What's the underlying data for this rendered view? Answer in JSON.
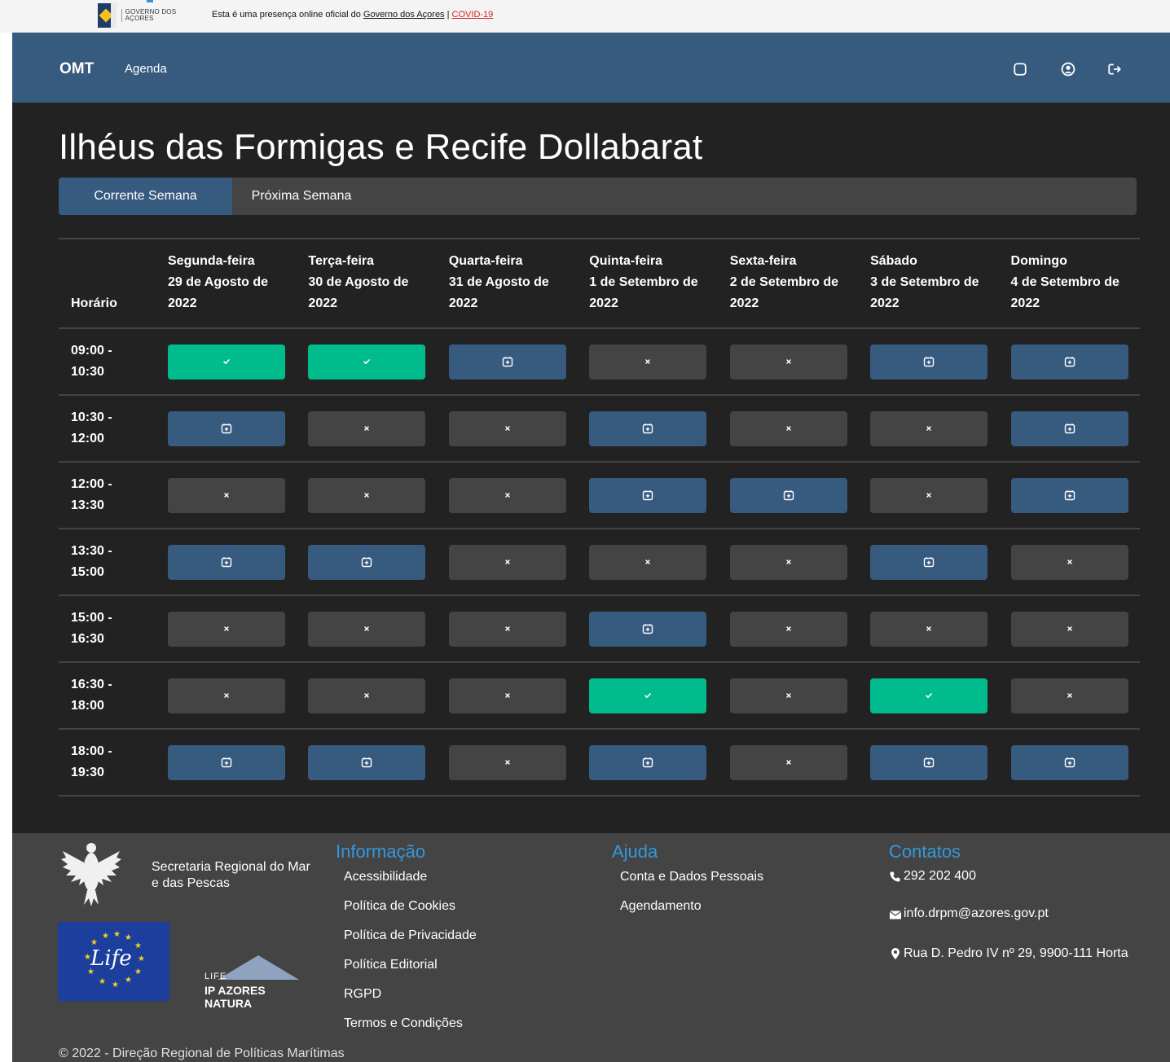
{
  "gov_bar": {
    "logo_text": "GOVERNO DOS AÇORES",
    "intro": "Esta é uma presença online oficial do ",
    "gov_link": "Governo dos Açores",
    "separator": " | ",
    "covid_link": "COVID-19"
  },
  "navbar": {
    "brand": "OMT",
    "agenda": "Agenda",
    "icons": [
      "theme-toggle-icon",
      "user-circle-icon",
      "logout-icon"
    ]
  },
  "page": {
    "title": "Ilhéus das Formigas e Recife Dollabarat",
    "tabs": [
      {
        "label": "Corrente Semana",
        "active": true
      },
      {
        "label": "Próxima Semana",
        "active": false
      }
    ]
  },
  "schedule": {
    "time_header": "Horário",
    "days": [
      {
        "name": "Segunda-feira",
        "date": "29 de Agosto de",
        "year": "2022"
      },
      {
        "name": "Terça-feira",
        "date": "30 de Agosto de",
        "year": "2022"
      },
      {
        "name": "Quarta-feira",
        "date": "31 de Agosto de",
        "year": "2022"
      },
      {
        "name": "Quinta-feira",
        "date": "1 de Setembro de",
        "year": "2022"
      },
      {
        "name": "Sexta-feira",
        "date": "2 de Setembro de",
        "year": "2022"
      },
      {
        "name": "Sábado",
        "date": "3 de Setembro de",
        "year": "2022"
      },
      {
        "name": "Domingo",
        "date": "4 de Setembro de",
        "year": "2022"
      }
    ],
    "rows": [
      {
        "start": "09:00 -",
        "end": "10:30",
        "slots": [
          "booked",
          "booked",
          "available",
          "unavailable",
          "unavailable",
          "available",
          "available"
        ]
      },
      {
        "start": "10:30 -",
        "end": "12:00",
        "slots": [
          "available",
          "unavailable",
          "unavailable",
          "available",
          "unavailable",
          "unavailable",
          "available"
        ]
      },
      {
        "start": "12:00 -",
        "end": "13:30",
        "slots": [
          "unavailable",
          "unavailable",
          "unavailable",
          "available",
          "available",
          "unavailable",
          "available"
        ]
      },
      {
        "start": "13:30 -",
        "end": "15:00",
        "slots": [
          "available",
          "available",
          "unavailable",
          "unavailable",
          "unavailable",
          "available",
          "unavailable"
        ]
      },
      {
        "start": "15:00 -",
        "end": "16:30",
        "slots": [
          "unavailable",
          "unavailable",
          "unavailable",
          "available",
          "unavailable",
          "unavailable",
          "unavailable"
        ]
      },
      {
        "start": "16:30 -",
        "end": "18:00",
        "slots": [
          "unavailable",
          "unavailable",
          "unavailable",
          "booked",
          "unavailable",
          "booked",
          "unavailable"
        ]
      },
      {
        "start": "18:00 -",
        "end": "19:30",
        "slots": [
          "available",
          "available",
          "unavailable",
          "available",
          "unavailable",
          "available",
          "available"
        ]
      }
    ],
    "colors": {
      "booked": "#00bc8c",
      "available": "#375a7f",
      "unavailable": "#444444"
    }
  },
  "footer": {
    "secretaria": "Secretaria Regional do Mar e das Pescas",
    "life_logo_text": "Life",
    "ipnatura_life": "LIFE",
    "ipnatura_name": "IP AZORES NATURA",
    "info": {
      "title": "Informação",
      "links": [
        "Acessibilidade",
        "Política de Cookies",
        "Política de Privacidade",
        "Política Editorial",
        "RGPD",
        "Termos e Condições"
      ]
    },
    "help": {
      "title": "Ajuda",
      "links": [
        "Conta e Dados Pessoais",
        "Agendamento"
      ]
    },
    "contacts": {
      "title": "Contatos",
      "phone": "292 202 400",
      "email": "info.drpm@azores.gov.pt",
      "address": "Rua D. Pedro IV nº 29, 9900-111 Horta"
    },
    "copyright": "© 2022 - Direção Regional de Políticas Marítimas"
  }
}
